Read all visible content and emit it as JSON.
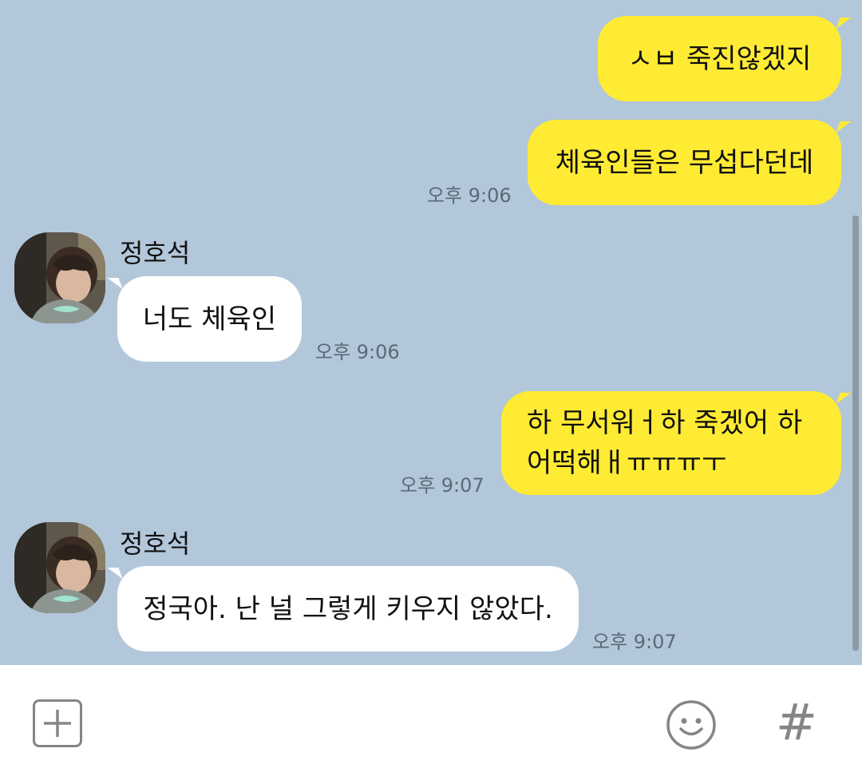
{
  "messages": {
    "m1": {
      "text": "ㅅㅂ 죽진않겠지"
    },
    "m2": {
      "text": "체육인들은 무섭다던데",
      "time": "오후 9:06"
    },
    "m3": {
      "sender": "정호석",
      "text": "너도 체육인",
      "time": "오후 9:06"
    },
    "m4": {
      "line1": "하 무서워ㅓ하 죽겠어 하",
      "line2": "어떡해ㅐㅠㅠㅠㅜ",
      "time": "오후 9:07"
    },
    "m5": {
      "sender": "정호석",
      "text": "정국아. 난 널 그렇게 키우지 않았다.",
      "time": "오후 9:07"
    }
  },
  "input_bar": {
    "plus_icon": "plus-icon",
    "emoji_icon": "smiley-icon",
    "hash_label": "#"
  },
  "colors": {
    "chat_background": "#b2c7da",
    "my_bubble": "#ffeb33",
    "other_bubble": "#ffffff"
  }
}
